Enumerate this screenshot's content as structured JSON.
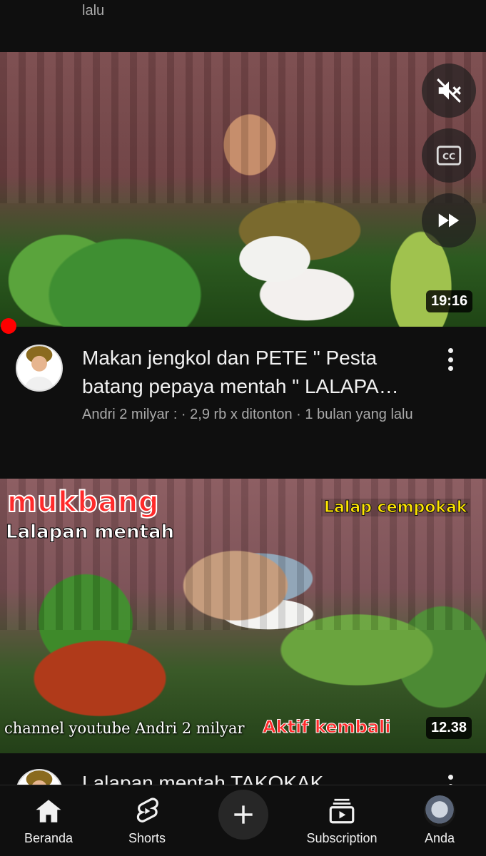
{
  "previous_item": {
    "subtitle_tail": "lalu"
  },
  "videos": [
    {
      "title": "Makan jengkol dan PETE \" Pesta batang pepaya mentah \" LALAPA…",
      "subtitle": "Andri 2 milyar : · 2,9 rb x ditonton · 1 bulan yang lalu",
      "duration": "19:16",
      "overlay_controls": [
        "mute-icon",
        "closed-captions-icon",
        "fast-forward-icon"
      ]
    },
    {
      "title": "Lalapan mentah TAKOKAK",
      "duration": "12.38",
      "thumbnail_text": {
        "mukbang": "mukbang",
        "lalapan": "Lalapan mentah",
        "cempokak": "Lalap cempokak",
        "channel": "channel youtube Andri 2 milyar",
        "aktif": "Aktif  kembali"
      }
    }
  ],
  "bottom_nav": {
    "items": [
      {
        "label": "Beranda",
        "icon": "home-icon"
      },
      {
        "label": "Shorts",
        "icon": "shorts-icon"
      },
      {
        "label": "",
        "icon": "plus-icon"
      },
      {
        "label": "Subscription",
        "icon": "subscriptions-icon"
      },
      {
        "label": "Anda",
        "icon": "avatar"
      }
    ]
  },
  "colors": {
    "background": "#0f0f0f",
    "progress_red": "#ff0000",
    "secondary_text": "#aaaaaa"
  }
}
